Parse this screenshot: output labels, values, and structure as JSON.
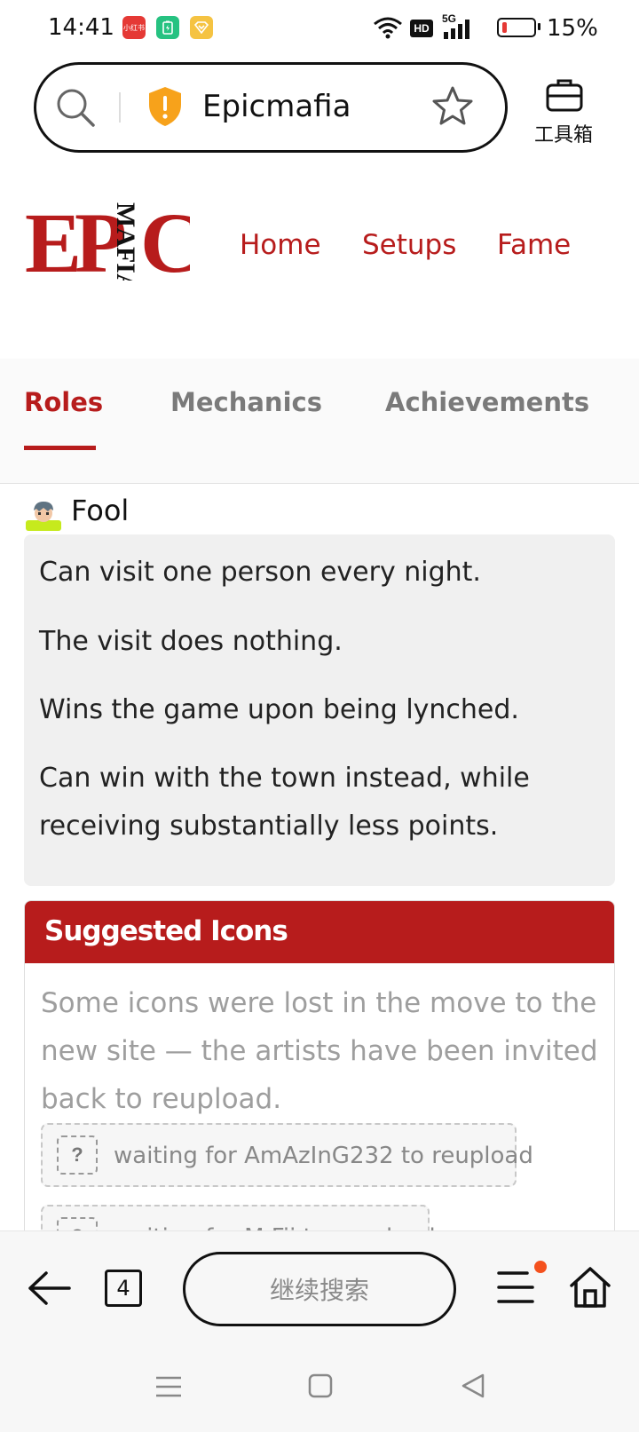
{
  "status_bar": {
    "time": "14:41",
    "app_icons": [
      {
        "name": "xiaohongshu-app",
        "label": "小红书",
        "color": "#e53935"
      },
      {
        "name": "battery-app",
        "label": "",
        "color": "#26c281"
      },
      {
        "name": "vip-app",
        "label": "",
        "color": "#f5c342"
      }
    ],
    "network": "5G",
    "hd": "HD",
    "battery_percent": "15%"
  },
  "address_bar": {
    "title": "Epicmafia",
    "toolbox_label": "工具箱"
  },
  "site": {
    "logo": {
      "main": "EPIC",
      "sub": "MAFIA",
      "color": "#b71c1c"
    },
    "nav": [
      "Home",
      "Setups",
      "Fame"
    ],
    "accent_color": "#b71c1c"
  },
  "tabs": [
    {
      "label": "Roles",
      "active": true
    },
    {
      "label": "Mechanics",
      "active": false
    },
    {
      "label": "Achievements",
      "active": false
    }
  ],
  "role": {
    "name": "Fool",
    "description": [
      "Can visit one person every night.",
      "The visit does nothing.",
      "Wins the game upon being lynched.",
      "Can win with the town instead, while receiving substantially less points."
    ]
  },
  "suggested_icons": {
    "title": "Suggested Icons",
    "text": "Some icons were lost in the move to the new site — the artists have been invited back to reupload.",
    "waiting": [
      {
        "badge": "?",
        "text": "waiting for AmAzInG232 to reupload"
      },
      {
        "badge": "?",
        "text": "waiting for M.Fii to reupload"
      }
    ]
  },
  "bottom_bar": {
    "tab_count": "4",
    "continue_search": "继续搜索"
  }
}
